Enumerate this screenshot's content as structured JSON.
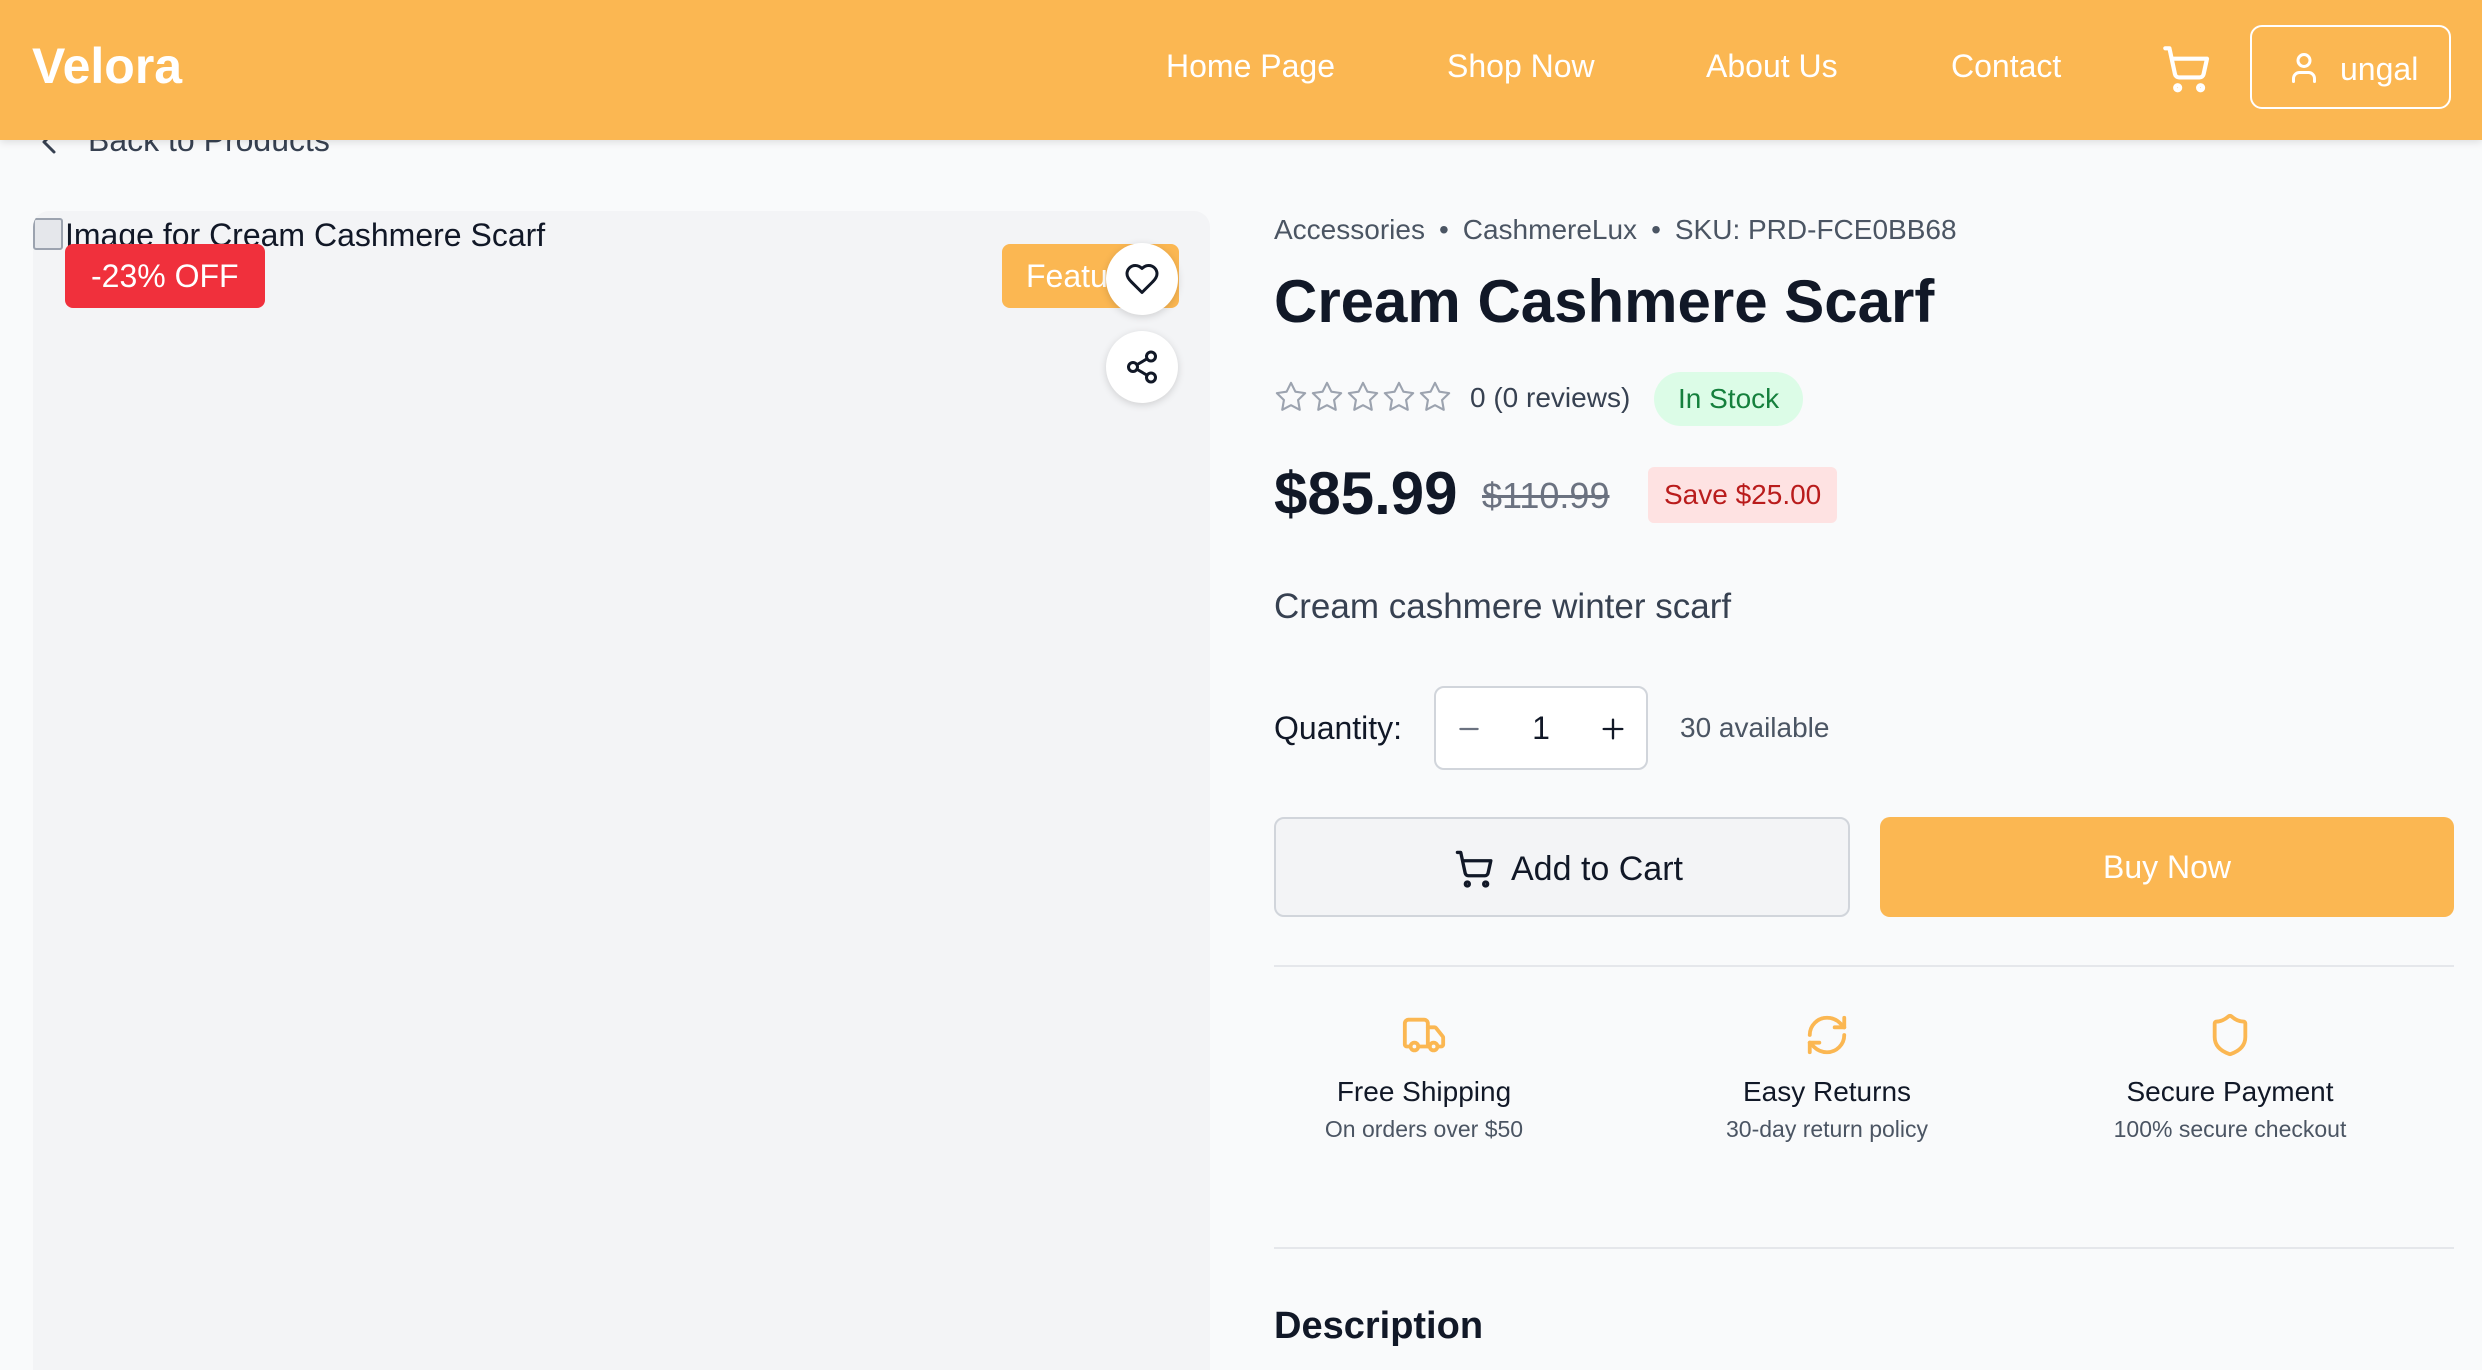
{
  "header": {
    "logo": "Velora",
    "nav": [
      "Home Page",
      "Shop Now",
      "About Us",
      "Contact"
    ],
    "user_name": "ungal"
  },
  "back_link": "Back to Products",
  "image": {
    "alt_text": "Image for Cream Cashmere Scarf",
    "discount_badge": "-23% OFF",
    "featured_badge": "Featured"
  },
  "product": {
    "category": "Accessories",
    "brand": "CashmereLux",
    "sku": "SKU: PRD-FCE0BB68",
    "title": "Cream Cashmere Scarf",
    "rating": 0,
    "rating_text": "0 (0 reviews)",
    "stock_status": "In Stock",
    "price": "$85.99",
    "original_price": "$110.99",
    "save_text": "Save $25.00",
    "short_description": "Cream cashmere winter scarf",
    "quantity_label": "Quantity:",
    "quantity": "1",
    "available": "30 available",
    "add_to_cart": "Add to Cart",
    "buy_now": "Buy Now"
  },
  "features": [
    {
      "icon": "truck-icon",
      "title": "Free Shipping",
      "subtitle": "On orders over $50"
    },
    {
      "icon": "refresh-icon",
      "title": "Easy Returns",
      "subtitle": "30-day return policy"
    },
    {
      "icon": "shield-icon",
      "title": "Secure Payment",
      "subtitle": "100% secure checkout"
    }
  ],
  "description_heading": "Description",
  "colors": {
    "brand": "#fbb752",
    "discount": "#f0303c",
    "stock_bg": "#dcfce7",
    "stock_text": "#15803d",
    "save_bg": "#fee2e2",
    "save_text": "#b91c1c"
  }
}
